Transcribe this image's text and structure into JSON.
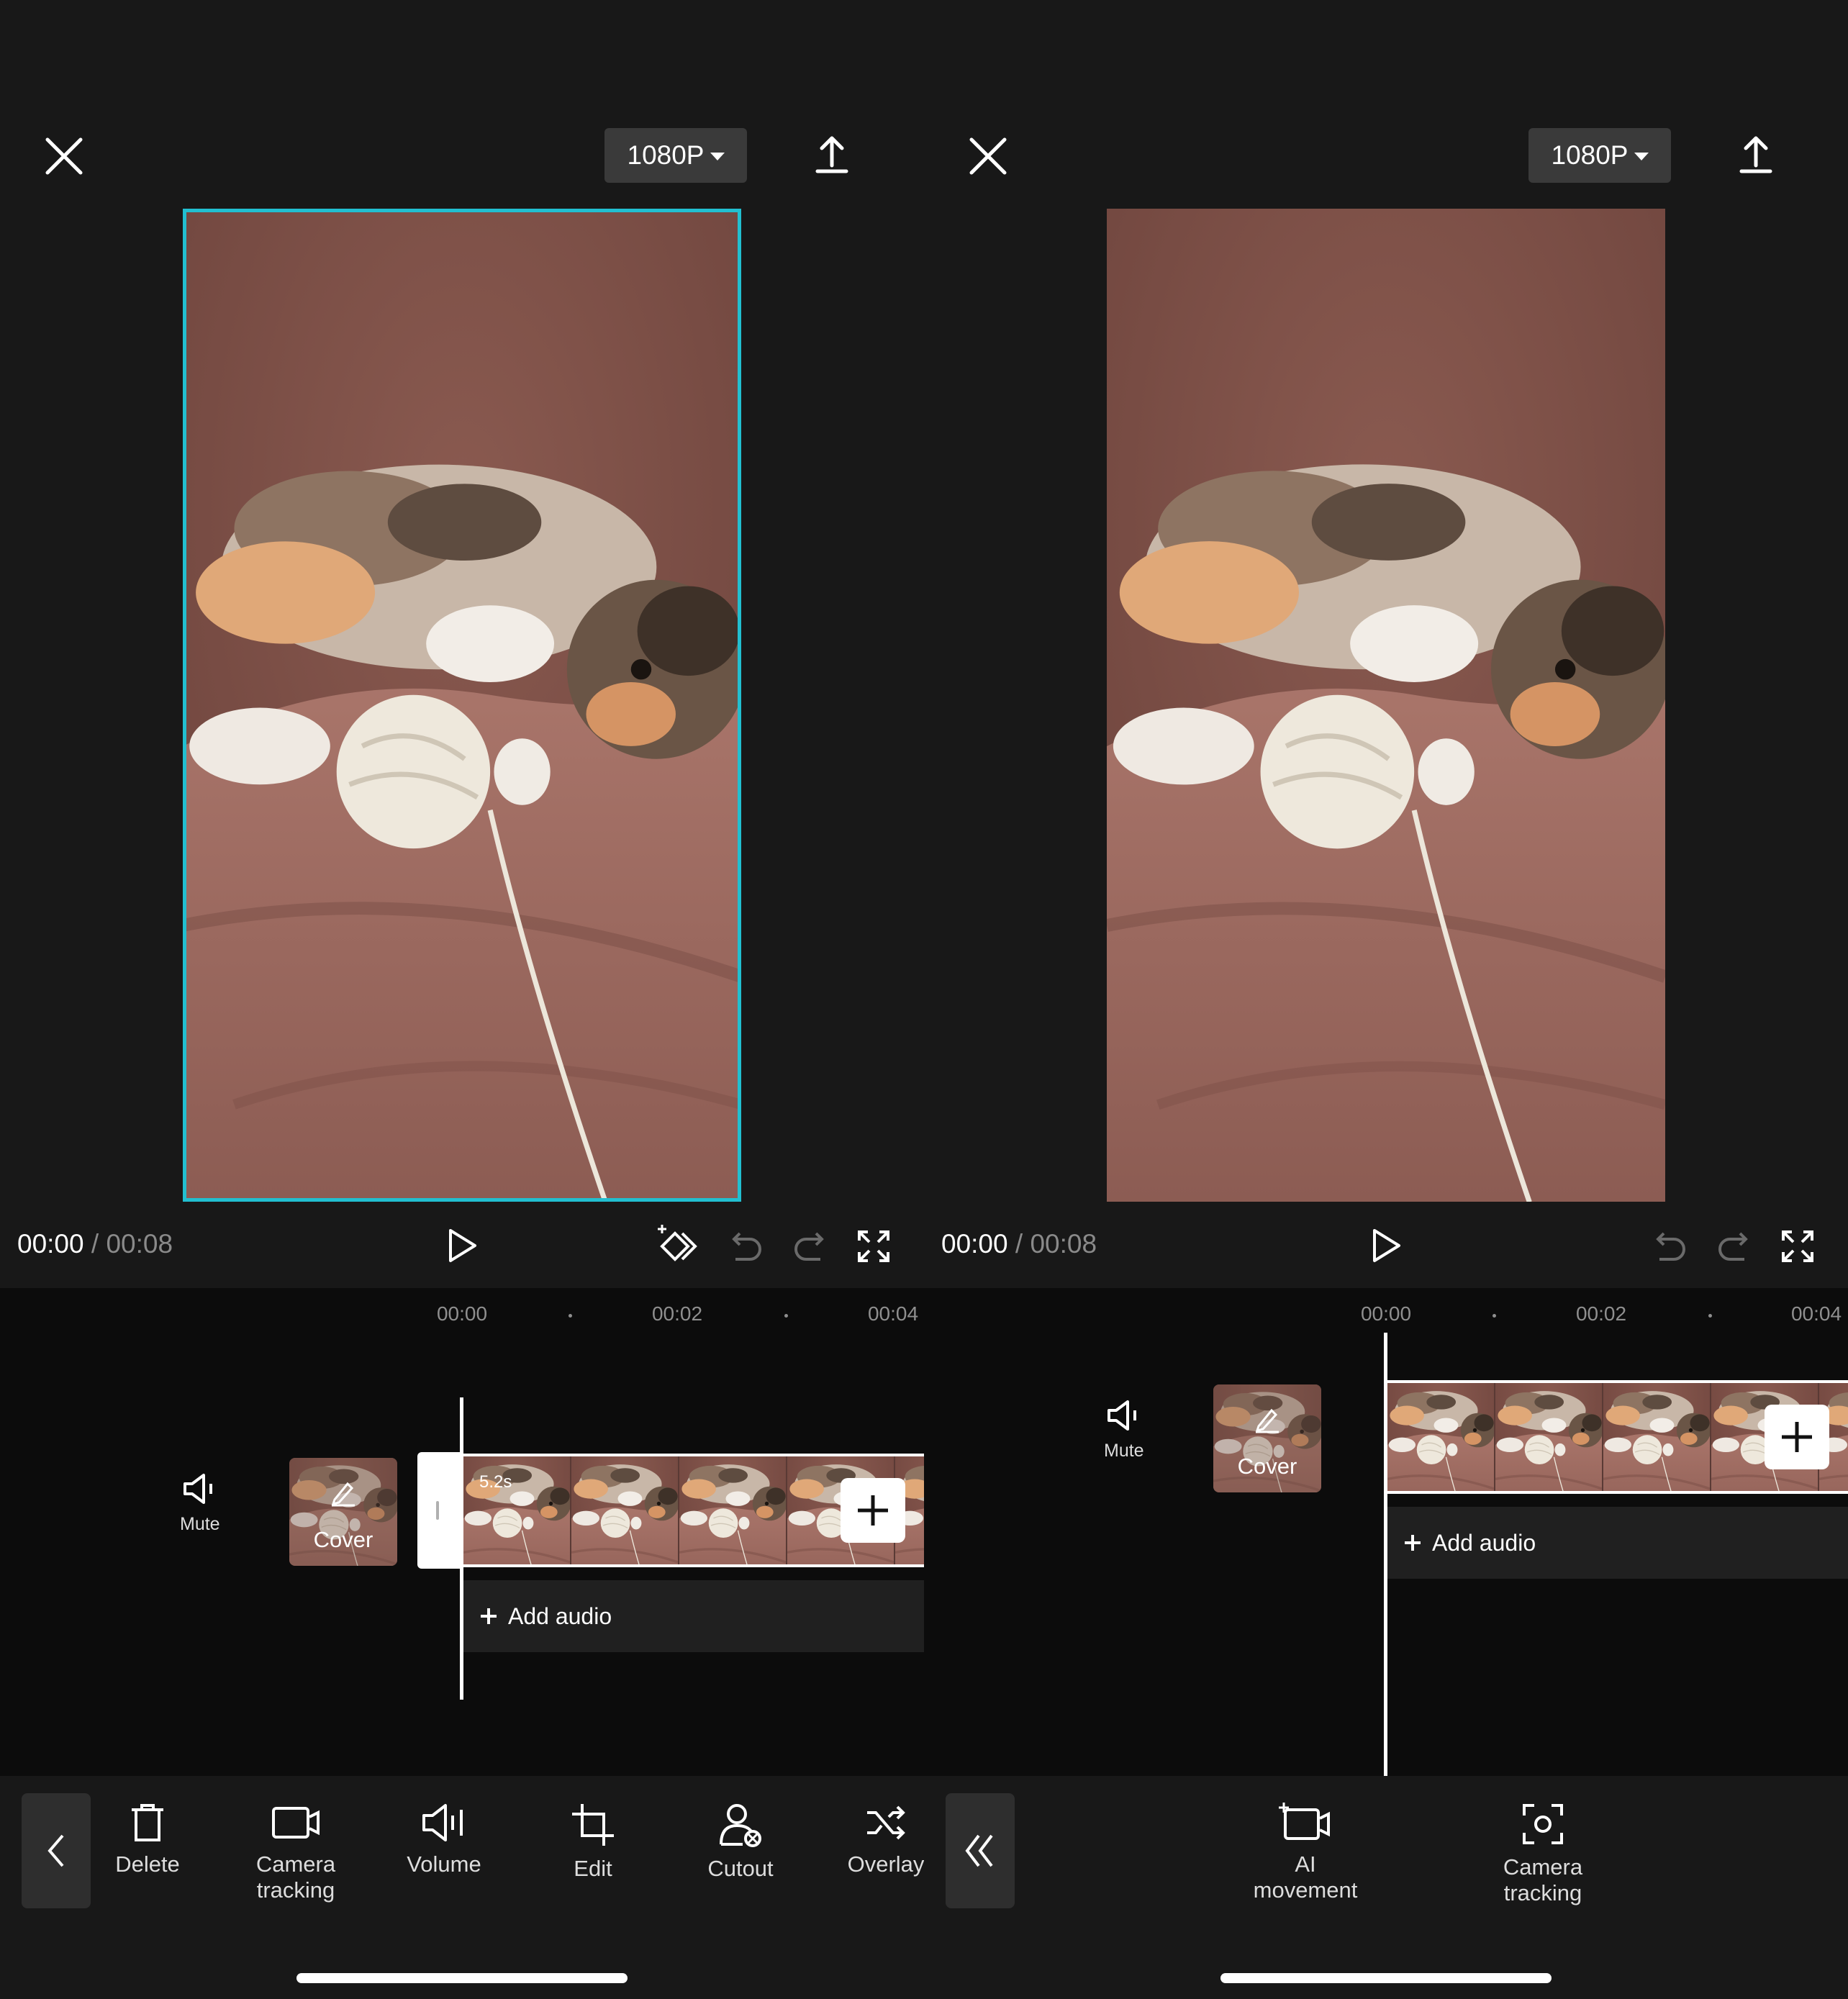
{
  "panels": [
    {
      "resolution": "1080P",
      "time_current": "00:00",
      "time_separator": "/",
      "time_total": "00:08",
      "ticks": [
        "00:00",
        "00:02",
        "00:04"
      ],
      "mute_label": "Mute",
      "cover_label": "Cover",
      "clip_duration": "5.2s",
      "add_audio_label": "Add audio",
      "tools": [
        {
          "icon": "trash-icon",
          "label": "Delete"
        },
        {
          "icon": "camera-icon",
          "label": "Camera\ntracking"
        },
        {
          "icon": "volume-icon",
          "label": "Volume"
        },
        {
          "icon": "crop-icon",
          "label": "Edit"
        },
        {
          "icon": "cutout-icon",
          "label": "Cutout"
        },
        {
          "icon": "shuffle-icon",
          "label": "Overlay"
        }
      ]
    },
    {
      "resolution": "1080P",
      "time_current": "00:00",
      "time_separator": "/",
      "time_total": "00:08",
      "ticks": [
        "00:00",
        "00:02",
        "00:04"
      ],
      "mute_label": "Mute",
      "cover_label": "Cover",
      "add_audio_label": "Add audio",
      "tools": [
        {
          "icon": "ai-movement-icon",
          "label": "AI\nmovement"
        },
        {
          "icon": "camera-tracking-icon",
          "label": "Camera\ntracking"
        }
      ]
    }
  ],
  "colors": {
    "background": "#181818",
    "timeline_background": "#0c0c0c",
    "selection_border": "#22bfd0",
    "button_background": "#3a3a3a"
  }
}
